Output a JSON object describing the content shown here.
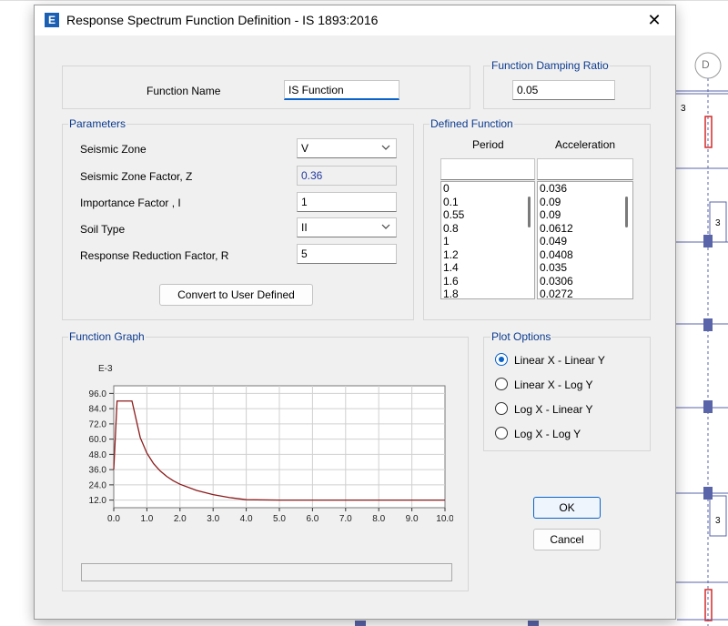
{
  "dialog": {
    "title": "Response Spectrum Function Definition - IS 1893:2016",
    "app_icon_letter": "E",
    "close_glyph": "✕"
  },
  "function_name": {
    "label": "Function Name",
    "value": "IS Function"
  },
  "damping": {
    "group_label": "Function Damping Ratio",
    "value": "0.05"
  },
  "parameters": {
    "group_label": "Parameters",
    "seismic_zone": {
      "label": "Seismic Zone",
      "value": "V"
    },
    "zone_factor": {
      "label": "Seismic Zone Factor, Z",
      "value": "0.36"
    },
    "importance_factor": {
      "label": "Importance Factor , I",
      "value": "1"
    },
    "soil_type": {
      "label": "Soil Type",
      "value": "II"
    },
    "response_reduction": {
      "label": "Response Reduction Factor, R",
      "value": "5"
    },
    "convert_button": "Convert to User Defined"
  },
  "defined_function": {
    "group_label": "Defined Function",
    "period_header": "Period",
    "acceleration_header": "Acceleration",
    "periods": [
      "0",
      "0.1",
      "0.55",
      "0.8",
      "1",
      "1.2",
      "1.4",
      "1.6",
      "1.8"
    ],
    "accelerations": [
      "0.036",
      "0.09",
      "0.09",
      "0.0612",
      "0.049",
      "0.0408",
      "0.035",
      "0.0306",
      "0.0272"
    ]
  },
  "graph": {
    "group_label": "Function Graph",
    "exponent_label": "E-3",
    "y_ticks": [
      "96.0",
      "84.0",
      "72.0",
      "60.0",
      "48.0",
      "36.0",
      "24.0",
      "12.0"
    ],
    "x_ticks": [
      "0.0",
      "1.0",
      "2.0",
      "3.0",
      "4.0",
      "5.0",
      "6.0",
      "7.0",
      "8.0",
      "9.0",
      "10.0"
    ]
  },
  "plot_options": {
    "group_label": "Plot Options",
    "options": [
      {
        "label": "Linear X - Linear Y",
        "checked": true
      },
      {
        "label": "Linear X - Log Y",
        "checked": false
      },
      {
        "label": "Log X - Linear Y",
        "checked": false
      },
      {
        "label": "Log X - Log Y",
        "checked": false
      }
    ]
  },
  "buttons": {
    "ok": "OK",
    "cancel": "Cancel"
  },
  "background": {
    "grid_label": "D",
    "beam_labels": [
      "3",
      "3",
      "3"
    ]
  },
  "colors": {
    "accent": "#0a63c9",
    "curve": "#8b1a1a",
    "group_label": "#0b3a8f"
  },
  "chart_data": {
    "type": "line",
    "x": [
      0,
      0.1,
      0.55,
      0.8,
      1,
      1.2,
      1.4,
      1.6,
      1.8,
      2,
      2.5,
      3,
      3.5,
      4,
      5,
      6,
      7,
      8,
      9,
      10
    ],
    "series": [
      {
        "values": [
          36,
          90,
          90,
          61.2,
          49,
          40.8,
          35,
          30.6,
          27.2,
          24.5,
          19.6,
          16.3,
          14,
          12.3,
          12,
          12,
          12,
          12,
          12,
          12
        ]
      }
    ],
    "xlim": [
      0,
      10
    ],
    "ylim": [
      6,
      102
    ],
    "y_unit_label": "E-3",
    "grid": true
  }
}
